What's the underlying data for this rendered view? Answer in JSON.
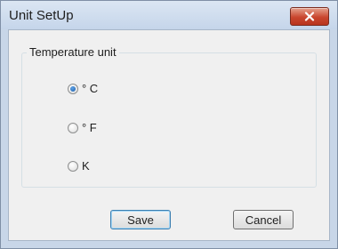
{
  "window": {
    "title": "Unit SetUp",
    "close_icon": "close-icon"
  },
  "temperature_group": {
    "label": "Temperature unit",
    "options": [
      {
        "label": "° C",
        "selected": true
      },
      {
        "label": "° F",
        "selected": false
      },
      {
        "label": "K",
        "selected": false
      }
    ]
  },
  "buttons": {
    "save_label": "Save",
    "cancel_label": "Cancel"
  },
  "colors": {
    "close_button": "#c9462e",
    "radio_selected": "#1b5ca8"
  }
}
